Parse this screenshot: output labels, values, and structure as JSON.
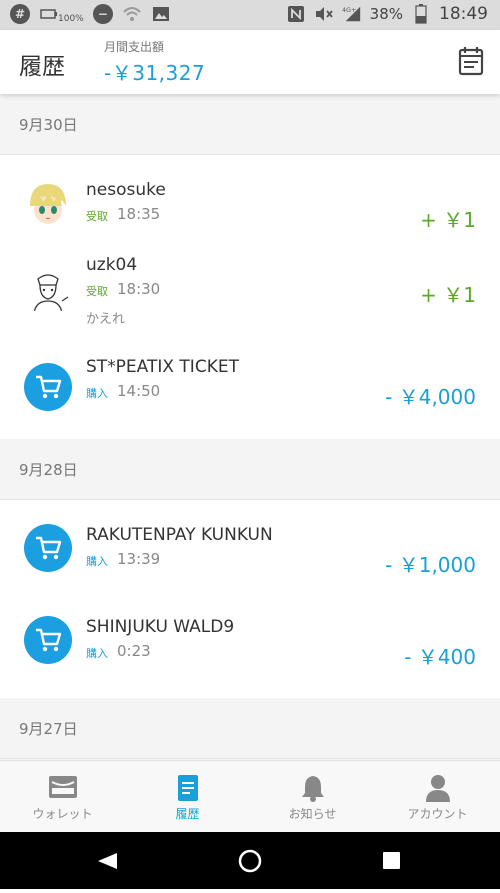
{
  "status_bar": {
    "left_icons": [
      "hash-icon",
      "battery-saver-icon",
      "dnd-icon",
      "wifi-icon",
      "image-icon"
    ],
    "battery_badge": "100%",
    "battery_percent": "38%",
    "time": "18:49",
    "network": "4G+"
  },
  "header": {
    "title": "履歴",
    "spend_label": "月間支出額",
    "spend_amount": "-￥31,327"
  },
  "sections": [
    {
      "date": "9月30日",
      "items": [
        {
          "name": "nesosuke",
          "kind": "受取",
          "time": "18:35",
          "amount": "+ ￥1",
          "type": "receive",
          "avatar": "anime-avatar"
        },
        {
          "name": "uzk04",
          "kind": "受取",
          "time": "18:30",
          "memo": "かえれ",
          "amount": "+ ￥1",
          "type": "receive",
          "avatar": "sketch-avatar"
        },
        {
          "name": "ST*PEATIX TICKET",
          "kind": "購入",
          "time": "14:50",
          "amount": "- ￥4,000",
          "type": "purchase"
        }
      ]
    },
    {
      "date": "9月28日",
      "items": [
        {
          "name": "RAKUTENPAY KUNKUN",
          "kind": "購入",
          "time": "13:39",
          "amount": "- ￥1,000",
          "type": "purchase"
        },
        {
          "name": "SHINJUKU WALD9",
          "kind": "購入",
          "time": "0:23",
          "amount": "- ￥400",
          "type": "purchase"
        }
      ]
    },
    {
      "date": "9月27日",
      "items": []
    }
  ],
  "bottom_nav": [
    {
      "label": "ウォレット",
      "icon": "wallet-icon",
      "active": false
    },
    {
      "label": "履歴",
      "icon": "history-icon",
      "active": true
    },
    {
      "label": "お知らせ",
      "icon": "bell-icon",
      "active": false
    },
    {
      "label": "アカウント",
      "icon": "account-icon",
      "active": false
    }
  ],
  "colors": {
    "accent": "#1aa0d8",
    "receive": "#5aa92a",
    "cart_bg": "#1b9fe0"
  }
}
